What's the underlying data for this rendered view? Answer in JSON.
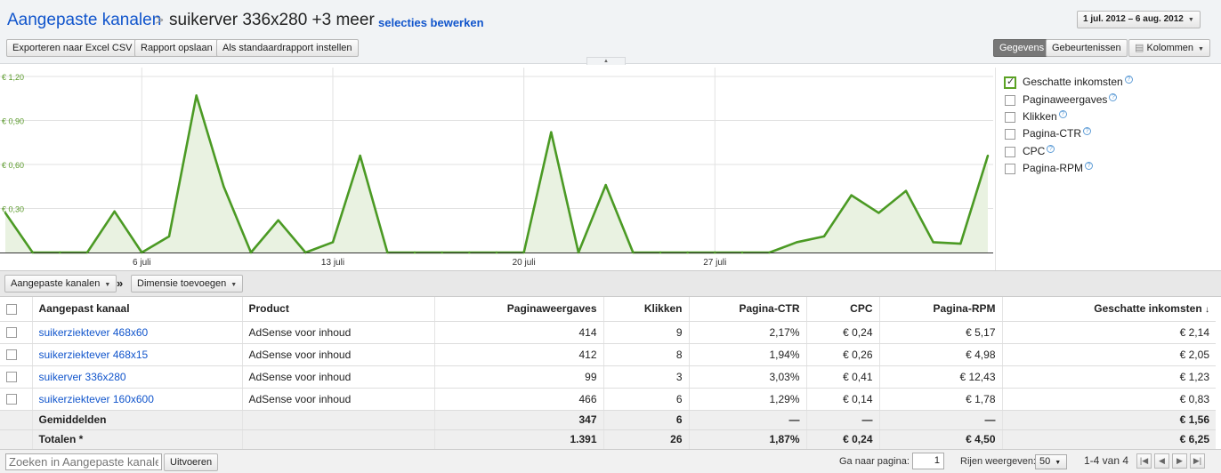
{
  "header": {
    "breadcrumb_root": "Aangepaste kanalen",
    "breadcrumb_sep": ">",
    "breadcrumb_current": "suikerver 336x280 +3 meer",
    "edit_selection": "selecties bewerken",
    "date_range": "1 jul. 2012 – 6 aug. 2012"
  },
  "toolbar": {
    "export_csv": "Exporteren naar Excel CSV",
    "save_report": "Rapport opslaan",
    "set_default": "Als standaardrapport instellen",
    "view_data": "Gegevens",
    "view_events": "Gebeurtenissen",
    "columns": "Kolommen"
  },
  "chart_data": {
    "type": "area",
    "x_tick_labels": [
      "6 juli",
      "13 juli",
      "20 juli",
      "27 juli"
    ],
    "y_tick_labels": [
      "€ 1,20",
      "€ 0,90",
      "€ 0,60",
      "€ 0,30"
    ],
    "ylim": [
      0,
      1.2
    ],
    "color": "#4b9a24",
    "fill": "#e9f2e1",
    "series": [
      {
        "name": "Geschatte inkomsten",
        "x": [
          "2012-07-01",
          "2012-07-02",
          "2012-07-03",
          "2012-07-04",
          "2012-07-05",
          "2012-07-06",
          "2012-07-07",
          "2012-07-08",
          "2012-07-09",
          "2012-07-10",
          "2012-07-11",
          "2012-07-12",
          "2012-07-13",
          "2012-07-14",
          "2012-07-15",
          "2012-07-16",
          "2012-07-17",
          "2012-07-18",
          "2012-07-19",
          "2012-07-20",
          "2012-07-21",
          "2012-07-22",
          "2012-07-23",
          "2012-07-24",
          "2012-07-25",
          "2012-07-26",
          "2012-07-27",
          "2012-07-28",
          "2012-07-29",
          "2012-07-30",
          "2012-07-31",
          "2012-08-01",
          "2012-08-02",
          "2012-08-03",
          "2012-08-04",
          "2012-08-05",
          "2012-08-06"
        ],
        "values": [
          0.27,
          0,
          0,
          0,
          0.28,
          0,
          0.11,
          1.07,
          0.45,
          0,
          0.22,
          0,
          0.07,
          0.66,
          0,
          0,
          0,
          0,
          0,
          0,
          0.82,
          0,
          0.46,
          0,
          0,
          0,
          0,
          0,
          0,
          0.07,
          0.11,
          0.39,
          0.27,
          0.42,
          0.07,
          0.06,
          0.66
        ]
      }
    ]
  },
  "legend": [
    {
      "label": "Geschatte inkomsten",
      "checked": true
    },
    {
      "label": "Paginaweergaves",
      "checked": false
    },
    {
      "label": "Klikken",
      "checked": false
    },
    {
      "label": "Pagina-CTR",
      "checked": false
    },
    {
      "label": "CPC",
      "checked": false
    },
    {
      "label": "Pagina-RPM",
      "checked": false
    }
  ],
  "dimbar": {
    "dimension": "Aangepaste kanalen",
    "separator": "»",
    "add_dimension": "Dimensie toevoegen"
  },
  "table": {
    "columns": [
      "Aangepast kanaal",
      "Product",
      "Paginaweergaves",
      "Klikken",
      "Pagina-CTR",
      "CPC",
      "Pagina-RPM",
      "Geschatte inkomsten"
    ],
    "sort_indicator": "↓",
    "rows": [
      [
        "suikerziektever 468x60",
        "AdSense voor inhoud",
        "414",
        "9",
        "2,17%",
        "€ 0,24",
        "€ 5,17",
        "€ 2,14"
      ],
      [
        "suikerziektever 468x15",
        "AdSense voor inhoud",
        "412",
        "8",
        "1,94%",
        "€ 0,26",
        "€ 4,98",
        "€ 2,05"
      ],
      [
        "suikerver 336x280",
        "AdSense voor inhoud",
        "99",
        "3",
        "3,03%",
        "€ 0,41",
        "€ 12,43",
        "€ 1,23"
      ],
      [
        "suikerziektever 160x600",
        "AdSense voor inhoud",
        "466",
        "6",
        "1,29%",
        "€ 0,14",
        "€ 1,78",
        "€ 0,83"
      ]
    ],
    "averages": [
      "Gemiddelden",
      "",
      "347",
      "6",
      "—",
      "—",
      "—",
      "€ 1,56"
    ],
    "totals": [
      "Totalen *",
      "",
      "1.391",
      "26",
      "1,87%",
      "€ 0,24",
      "€ 4,50",
      "€ 6,25"
    ]
  },
  "footer": {
    "search_placeholder": "Zoeken in Aangepaste kanalen",
    "search_button": "Uitvoeren",
    "goto_label": "Ga naar pagina:",
    "goto_value": "1",
    "rows_label": "Rijen weergeven:",
    "rows_value": "50",
    "range": "1-4 van 4"
  }
}
